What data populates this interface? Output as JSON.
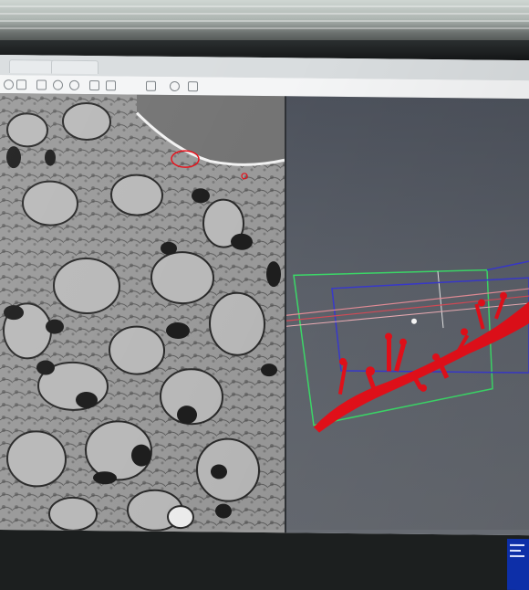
{
  "tabs": [
    {
      "label": ""
    },
    {
      "label": ""
    }
  ],
  "toolbar": {
    "icons": [
      "back-icon",
      "forward-icon",
      "home-icon",
      "zoom-in-icon",
      "zoom-out-icon",
      "pan-icon",
      "select-icon",
      "layers-icon",
      "settings-icon",
      "camera-icon"
    ]
  },
  "colors": {
    "em_background": "#8a8a8a",
    "viewer_background": "#5d626b",
    "segmentation_red": "#e8101a",
    "bbox_green": "#3ddc6a",
    "bbox_blue": "#3a3ad0",
    "hud_blue": "#0d2fa8"
  }
}
